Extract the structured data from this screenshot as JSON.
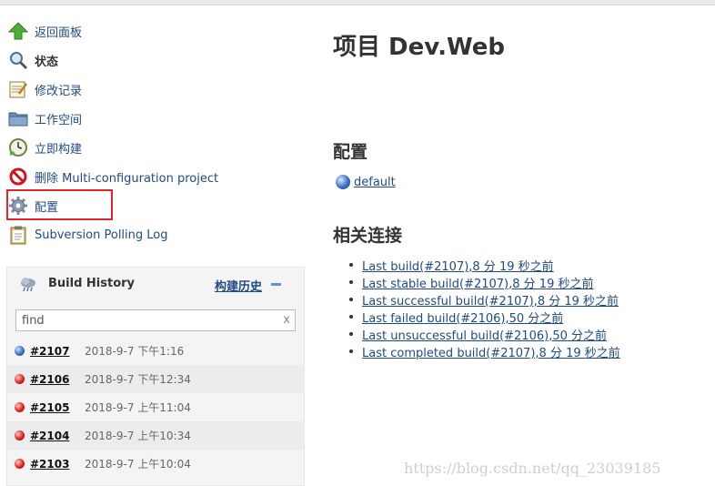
{
  "sidebar": {
    "items": [
      {
        "label": "返回面板",
        "icon": "up-arrow-icon"
      },
      {
        "label": "状态",
        "icon": "search-icon"
      },
      {
        "label": "修改记录",
        "icon": "notepad-icon"
      },
      {
        "label": "工作空间",
        "icon": "folder-icon"
      },
      {
        "label": "立即构建",
        "icon": "clock-icon"
      },
      {
        "label": "删除 Multi-configuration project",
        "icon": "no-entry-icon"
      },
      {
        "label": "配置",
        "icon": "gear-icon"
      },
      {
        "label": "Subversion Polling Log",
        "icon": "clipboard-icon"
      }
    ]
  },
  "build_history": {
    "title": "Build History",
    "trend_link": "构建历史",
    "search_placeholder": "find",
    "clear": "x",
    "rows": [
      {
        "number": "#2107",
        "date": "2018-9-7 下午1:16",
        "status": "blue"
      },
      {
        "number": "#2106",
        "date": "2018-9-7 下午12:34",
        "status": "red"
      },
      {
        "number": "#2105",
        "date": "2018-9-7 上午11:04",
        "status": "red"
      },
      {
        "number": "#2104",
        "date": "2018-9-7 上午10:34",
        "status": "red"
      },
      {
        "number": "#2103",
        "date": "2018-9-7 上午10:04",
        "status": "red"
      }
    ]
  },
  "main": {
    "title": "项目 Dev.Web",
    "config_heading": "配置",
    "config_link": "default",
    "related_heading": "相关连接",
    "related_links": [
      "Last build(#2107),8 分 19 秒之前",
      "Last stable build(#2107),8 分 19 秒之前",
      "Last successful build(#2107),8 分 19 秒之前",
      "Last failed build(#2106),50 分之前",
      "Last unsuccessful build(#2106),50 分之前",
      "Last completed build(#2107),8 分 19 秒之前"
    ]
  },
  "watermark": "https://blog.csdn.net/qq_23039185",
  "colors": {
    "link": "#204a87",
    "highlight": "#e3242b",
    "success": "#3a6fc4",
    "failure": "#e02020"
  }
}
